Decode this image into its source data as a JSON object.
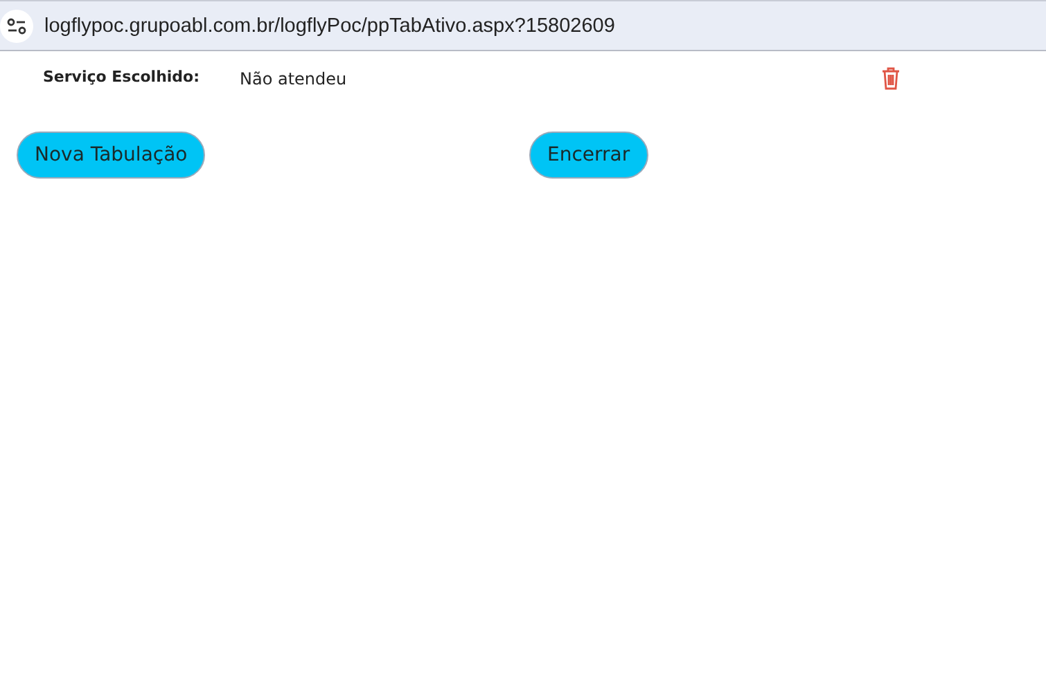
{
  "address_bar": {
    "url": "logflypoc.grupoabl.com.br/logflyPoc/ppTabAtivo.aspx?15802609"
  },
  "service": {
    "label": "Serviço Escolhido:",
    "value": "Não atendeu"
  },
  "buttons": [
    {
      "label": "Nova Tabulação"
    },
    {
      "label": "Encerrar"
    }
  ]
}
